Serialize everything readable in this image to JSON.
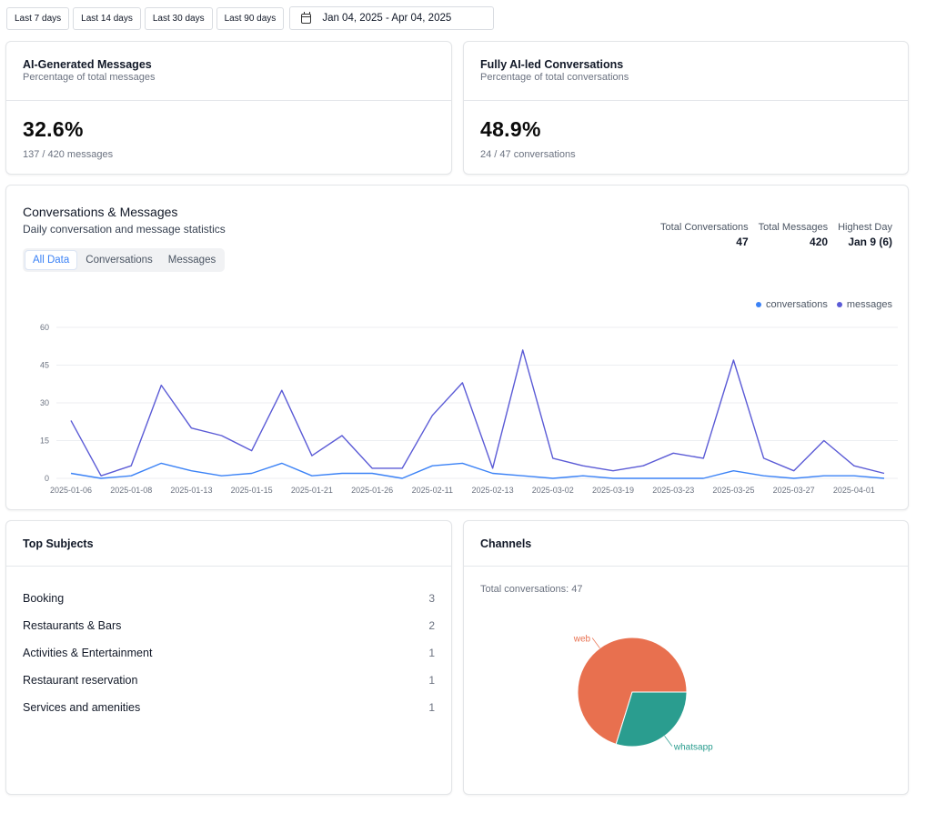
{
  "range_buttons": [
    "Last 7 days",
    "Last 14 days",
    "Last 30 days",
    "Last 90 days"
  ],
  "date_range": "Jan 04, 2025 - Apr 04, 2025",
  "ai_messages": {
    "title": "AI-Generated Messages",
    "subtitle": "Percentage of total messages",
    "value": "32.6%",
    "detail": "137 / 420 messages"
  },
  "ai_conversations": {
    "title": "Fully AI-led Conversations",
    "subtitle": "Percentage of total conversations",
    "value": "48.9%",
    "detail": "24 / 47 conversations"
  },
  "conv_chart": {
    "title": "Conversations & Messages",
    "subtitle": "Daily conversation and message statistics",
    "summary": [
      {
        "label": "Total Conversations",
        "value": "47"
      },
      {
        "label": "Total Messages",
        "value": "420"
      },
      {
        "label": "Highest Day",
        "value": "Jan 9 (6)"
      }
    ],
    "tabs": [
      "All Data",
      "Conversations",
      "Messages"
    ],
    "active_tab": 0,
    "legend": [
      {
        "name": "conversations",
        "color": "#3b82f6"
      },
      {
        "name": "messages",
        "color": "#5b5bd6"
      }
    ]
  },
  "chart_data": [
    {
      "type": "line",
      "x": [
        "2025-01-06",
        "2025-01-07",
        "2025-01-08",
        "2025-01-09",
        "2025-01-13",
        "2025-01-14",
        "2025-01-15",
        "2025-01-16",
        "2025-01-21",
        "2025-01-22",
        "2025-01-26",
        "2025-01-27",
        "2025-02-11",
        "2025-02-12",
        "2025-02-13",
        "2025-02-14",
        "2025-03-02",
        "2025-03-03",
        "2025-03-19",
        "2025-03-20",
        "2025-03-23",
        "2025-03-24",
        "2025-03-25",
        "2025-03-26",
        "2025-03-27",
        "2025-03-28",
        "2025-04-01",
        "2025-04-02"
      ],
      "xtick_labels": [
        "2025-01-06",
        "2025-01-08",
        "2025-01-13",
        "2025-01-15",
        "2025-01-21",
        "2025-01-26",
        "2025-02-11",
        "2025-02-13",
        "2025-03-02",
        "2025-03-19",
        "2025-03-23",
        "2025-03-25",
        "2025-03-27",
        "2025-04-01"
      ],
      "series": [
        {
          "name": "conversations",
          "color": "#3b82f6",
          "values": [
            2,
            0,
            1,
            6,
            3,
            1,
            2,
            6,
            1,
            2,
            2,
            0,
            5,
            6,
            2,
            1,
            0,
            1,
            0,
            0,
            0,
            0,
            3,
            1,
            0,
            1,
            1,
            0
          ]
        },
        {
          "name": "messages",
          "color": "#5b5bd6",
          "values": [
            23,
            1,
            5,
            37,
            20,
            17,
            11,
            35,
            9,
            17,
            4,
            4,
            25,
            38,
            4,
            51,
            8,
            5,
            3,
            5,
            10,
            8,
            47,
            8,
            3,
            15,
            5,
            2
          ]
        }
      ],
      "yticks": [
        0,
        15,
        30,
        45,
        60
      ],
      "ylim": [
        0,
        60
      ],
      "grid": true,
      "legend_position": "top-right"
    },
    {
      "type": "pie",
      "labels": [
        "web",
        "whatsapp"
      ],
      "values": [
        33,
        14
      ],
      "colors": [
        "#e8704f",
        "#2a9d8f"
      ]
    }
  ],
  "top_subjects": {
    "title": "Top Subjects",
    "items": [
      {
        "name": "Booking",
        "count": "3"
      },
      {
        "name": "Restaurants & Bars",
        "count": "2"
      },
      {
        "name": "Activities & Entertainment",
        "count": "1"
      },
      {
        "name": "Restaurant reservation",
        "count": "1"
      },
      {
        "name": "Services and amenities",
        "count": "1"
      }
    ]
  },
  "channels": {
    "title": "Channels",
    "total_text": "Total conversations: 47"
  }
}
